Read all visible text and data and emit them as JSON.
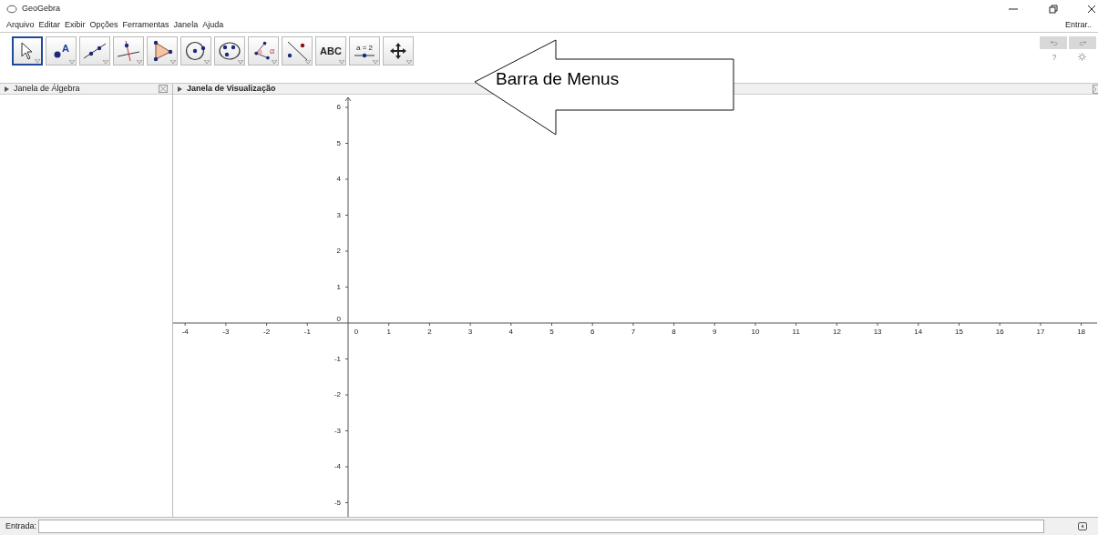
{
  "window": {
    "title": "GeoGebra"
  },
  "menu": [
    "Arquivo",
    "Editar",
    "Exibir",
    "Opções",
    "Ferramentas",
    "Janela",
    "Ajuda"
  ],
  "login": "Entrar..",
  "tools": [
    {
      "kind": "move",
      "selected": true
    },
    {
      "kind": "point",
      "selected": false,
      "label": "A"
    },
    {
      "kind": "line",
      "selected": false
    },
    {
      "kind": "perpendicular",
      "selected": false
    },
    {
      "kind": "polygon",
      "selected": false
    },
    {
      "kind": "circle",
      "selected": false
    },
    {
      "kind": "ellipse",
      "selected": false
    },
    {
      "kind": "angle",
      "selected": false,
      "label": "α"
    },
    {
      "kind": "reflect",
      "selected": false
    },
    {
      "kind": "text",
      "selected": false,
      "label": "ABC"
    },
    {
      "kind": "slider",
      "selected": false,
      "label": "a = 2"
    },
    {
      "kind": "pan",
      "selected": false
    }
  ],
  "undo": {
    "disabled": true
  },
  "redo": {
    "disabled": true
  },
  "help": "?",
  "algebra_panel": {
    "title": "Janela de Álgebra"
  },
  "graphics_panel": {
    "title": "Janela de Visualização",
    "x_negative_labels": [
      "-4",
      "-3",
      "-2",
      "-1"
    ],
    "x_positive_labels": [
      "0",
      "1",
      "2",
      "3",
      "4",
      "5",
      "6",
      "7",
      "8",
      "9",
      "10",
      "11",
      "12",
      "13",
      "14",
      "15",
      "16",
      "17",
      "18"
    ],
    "y_positive_labels": [
      "6",
      "5",
      "4",
      "3",
      "2",
      "1",
      "0"
    ],
    "y_negative_labels": [
      "-1",
      "-2",
      "-3",
      "-4",
      "-5"
    ]
  },
  "input_bar": {
    "label": "Entrada:"
  },
  "callout": {
    "text": "Barra de Menus"
  }
}
